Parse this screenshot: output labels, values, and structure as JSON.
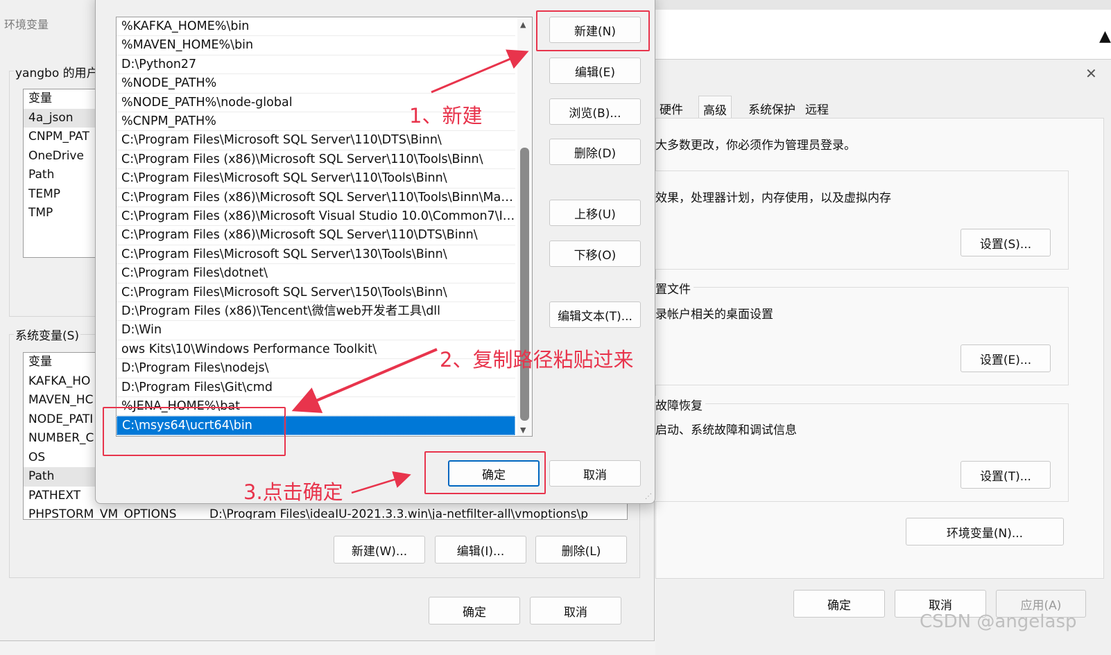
{
  "system_properties": {
    "tabs": [
      "硬件",
      "高级",
      "系统保护",
      "远程"
    ],
    "active_tab": "高级",
    "close_icon": "close-icon",
    "admin_note": "大多数更改，你必须作为管理员登录。",
    "performance_desc": "效果，处理器计划，内存使用，以及虚拟内存",
    "performance_settings": "设置(S)...",
    "profile_title": "置文件",
    "profile_desc": "录帐户相关的桌面设置",
    "profile_settings": "设置(E)...",
    "startup_title": "故障恢复",
    "startup_desc": "启动、系统故障和调试信息",
    "startup_settings": "设置(T)...",
    "env_button": "环境变量(N)...",
    "ok": "确定",
    "cancel": "取消",
    "apply": "应用(A)"
  },
  "env_window": {
    "title": "环境变量",
    "user_group": "yangbo 的用户",
    "user_vars": [
      "变量",
      "4a_json",
      "CNPM_PAT",
      "OneDrive",
      "Path",
      "TEMP",
      "TMP"
    ],
    "system_group": "系统变量(S)",
    "system_vars": [
      "变量",
      "KAFKA_HO",
      "MAVEN_HC",
      "NODE_PATI",
      "NUMBER_C",
      "OS",
      "Path",
      "PATHEXT",
      "PHPSTORM_VM_OPTIONS"
    ],
    "phpstorm_value": "D:\\Program Files\\ideaIU-2021.3.3.win\\ja-netfilter-all\\vmoptions\\p",
    "new_button": "新建(W)...",
    "edit_button": "编辑(I)...",
    "delete_button": "删除(L)",
    "ok": "确定",
    "cancel": "取消"
  },
  "path_dialog": {
    "entries": [
      "%KAFKA_HOME%\\bin",
      "%MAVEN_HOME%\\bin",
      "D:\\Python27",
      "%NODE_PATH%",
      "%NODE_PATH%\\node-global",
      "%CNPM_PATH%",
      "C:\\Program Files\\Microsoft SQL Server\\110\\DTS\\Binn\\",
      "C:\\Program Files (x86)\\Microsoft SQL Server\\110\\Tools\\Binn\\",
      "C:\\Program Files\\Microsoft SQL Server\\110\\Tools\\Binn\\",
      "C:\\Program Files (x86)\\Microsoft SQL Server\\110\\Tools\\Binn\\Man...",
      "C:\\Program Files (x86)\\Microsoft Visual Studio 10.0\\Common7\\ID...",
      "C:\\Program Files (x86)\\Microsoft SQL Server\\110\\DTS\\Binn\\",
      "C:\\Program Files\\Microsoft SQL Server\\130\\Tools\\Binn\\",
      "C:\\Program Files\\dotnet\\",
      "C:\\Program Files\\Microsoft SQL Server\\150\\Tools\\Binn\\",
      "D:\\Program Files (x86)\\Tencent\\微信web开发者工具\\dll",
      "D:\\Win",
      "ows Kits\\10\\Windows Performance Toolkit\\",
      "D:\\Program Files\\nodejs\\",
      "D:\\Program Files\\Git\\cmd",
      "%JENA_HOME%\\bat",
      "C:\\msys64\\ucrt64\\bin"
    ],
    "selected_index": 21,
    "buttons": {
      "new": "新建(N)",
      "edit": "编辑(E)",
      "browse": "浏览(B)...",
      "delete": "删除(D)",
      "move_up": "上移(U)",
      "move_down": "下移(O)",
      "edit_text": "编辑文本(T)...",
      "ok": "确定",
      "cancel": "取消"
    }
  },
  "annotations": {
    "step1": "1、新建",
    "step2": "2、复制路径粘贴过来",
    "step3": "3.点击确定",
    "color": "#e8344c"
  },
  "watermark": "CSDN @angelasp"
}
